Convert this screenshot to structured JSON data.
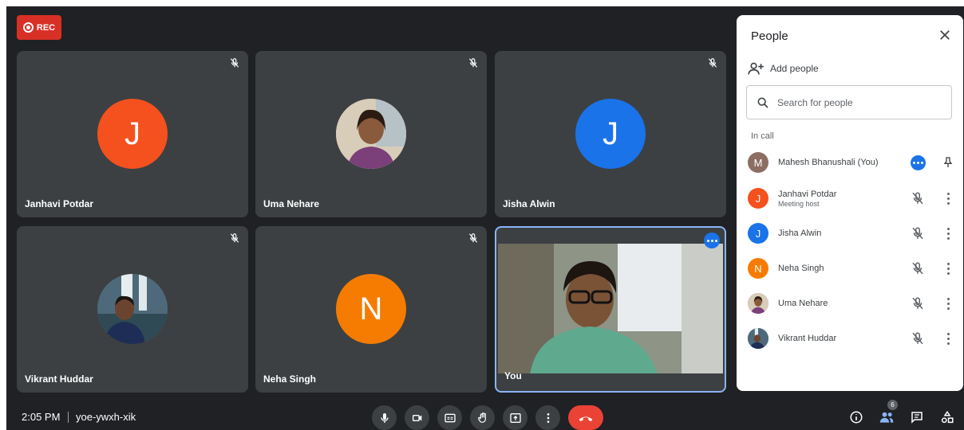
{
  "recording": {
    "label": "REC"
  },
  "tiles": [
    {
      "name": "Janhavi Potdar",
      "initial": "J",
      "color": "#f4511e"
    },
    {
      "name": "Uma Nehare",
      "initial": "",
      "color": "#a1887f"
    },
    {
      "name": "Jisha Alwin",
      "initial": "J",
      "color": "#1a73e8"
    },
    {
      "name": "Vikrant Huddar",
      "initial": "",
      "color": "#4e6a7a"
    },
    {
      "name": "Neha Singh",
      "initial": "N",
      "color": "#f57c00"
    },
    {
      "name": "You"
    }
  ],
  "panel": {
    "title": "People",
    "add_people": "Add people",
    "search_placeholder": "Search for people",
    "section": "In call",
    "participants": [
      {
        "name": "Mahesh Bhanushali (You)",
        "initial": "M",
        "color": "#8d6e63"
      },
      {
        "name": "Janhavi Potdar",
        "sub": "Meeting host",
        "initial": "J",
        "color": "#f4511e"
      },
      {
        "name": "Jisha Alwin",
        "initial": "J",
        "color": "#1a73e8"
      },
      {
        "name": "Neha Singh",
        "initial": "N",
        "color": "#f57c00"
      },
      {
        "name": "Uma Nehare",
        "initial": "",
        "color": "#a1887f"
      },
      {
        "name": "Vikrant Huddar",
        "initial": "",
        "color": "#4e6a7a"
      }
    ]
  },
  "bottom": {
    "time": "2:05 PM",
    "meeting_code": "yoe-ywxh-xik",
    "people_count": "6",
    "controls": [
      "microphone-icon",
      "camera-icon",
      "captions-icon",
      "raise-hand-icon",
      "present-icon",
      "more-options-icon",
      "hang-up-icon"
    ]
  },
  "colors": {
    "background": "#202124",
    "tile": "#3c4043",
    "hangup": "#ea4335",
    "accent": "#1a73e8"
  }
}
